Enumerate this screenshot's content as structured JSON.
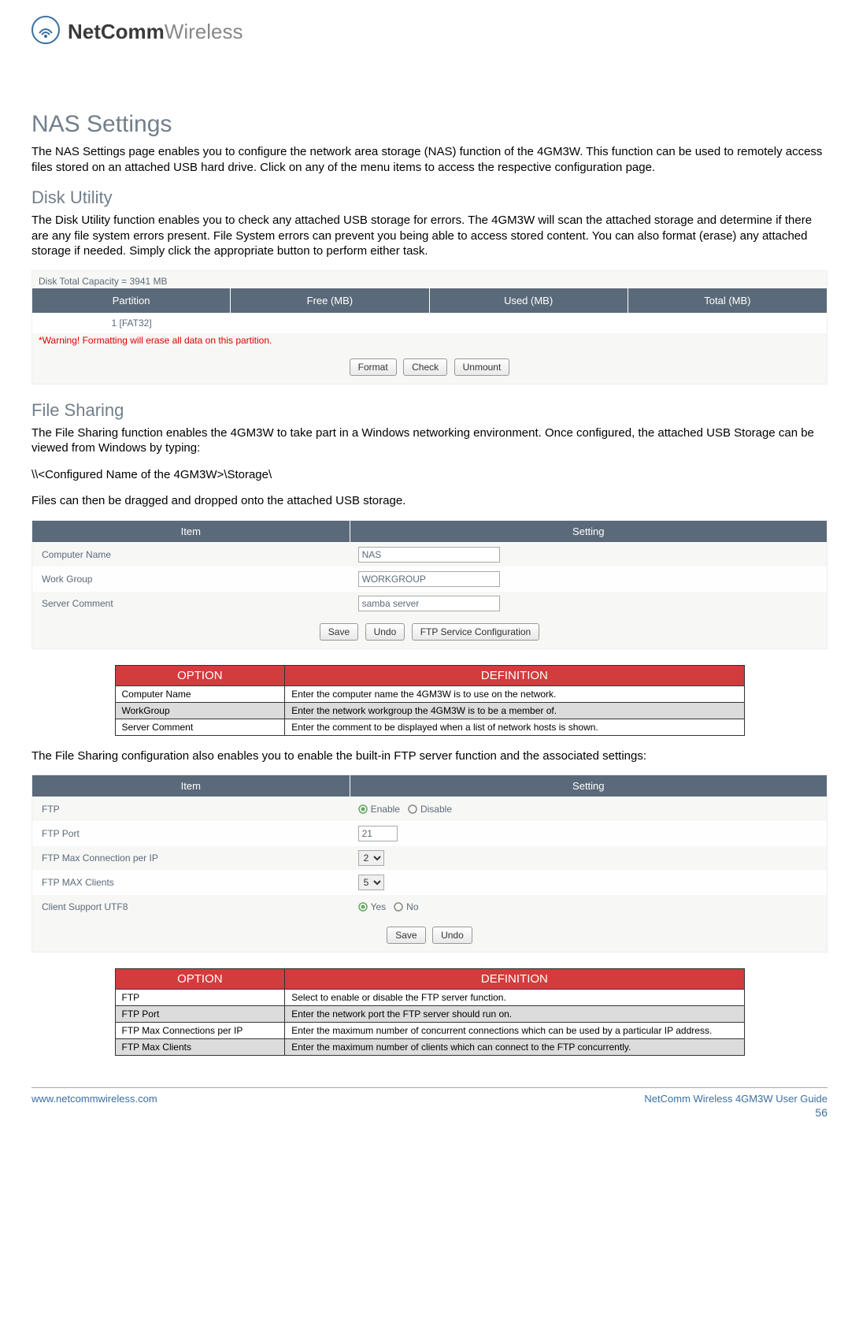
{
  "logo": {
    "bold": "NetComm",
    "light": "Wireless"
  },
  "h1": "NAS Settings",
  "intro": "The NAS Settings page enables you to configure the network area storage (NAS) function of the 4GM3W. This function can be used to remotely access files stored on an attached USB hard drive. Click on any of the menu items to access the respective configuration page.",
  "disk": {
    "title": "Disk Utility",
    "para": "The Disk Utility function enables you to check any attached USB storage for errors. The 4GM3W will scan the attached storage and determine if there are any file system errors present. File System errors can prevent you being able to access stored content. You can also format (erase) any attached storage if needed. Simply click the appropriate button to perform either task.",
    "capacity": "Disk Total Capacity = 3941 MB",
    "headers": [
      "Partition",
      "Free (MB)",
      "Used (MB)",
      "Total (MB)"
    ],
    "row": [
      "1 [FAT32]",
      "",
      "",
      ""
    ],
    "warning": "*Warning! Formatting will erase all data on this partition.",
    "buttons": [
      "Format",
      "Check",
      "Unmount"
    ]
  },
  "fs": {
    "title": "File Sharing",
    "p1": "The File Sharing function enables the 4GM3W to take part in a Windows networking environment. Once configured, the attached USB Storage can be viewed from Windows by typing:",
    "path": "\\\\<Configured Name of the 4GM3W>\\Storage\\",
    "p2": "Files can then be dragged and dropped onto the attached USB storage.",
    "headers": [
      "Item",
      "Setting"
    ],
    "rows": [
      {
        "label": "Computer Name",
        "value": "NAS"
      },
      {
        "label": "Work Group",
        "value": "WORKGROUP"
      },
      {
        "label": "Server Comment",
        "value": "samba server"
      }
    ],
    "buttons": [
      "Save",
      "Undo",
      "FTP Service Configuration"
    ]
  },
  "defs1": {
    "headers": [
      "OPTION",
      "DEFINITION"
    ],
    "rows": [
      [
        "Computer Name",
        "Enter the computer name the 4GM3W is to use on the network."
      ],
      [
        "WorkGroup",
        "Enter the network workgroup the 4GM3W is to be a member of."
      ],
      [
        "Server Comment",
        "Enter the comment to be displayed when a list of network hosts is shown."
      ]
    ]
  },
  "ftpIntro": "The File Sharing configuration also enables you to enable the built-in FTP server function and the associated settings:",
  "ftp": {
    "headers": [
      "Item",
      "Setting"
    ],
    "rows": [
      {
        "label": "FTP",
        "type": "radio",
        "opts": [
          "Enable",
          "Disable"
        ],
        "selected": "Enable"
      },
      {
        "label": "FTP Port",
        "type": "text",
        "value": "21"
      },
      {
        "label": "FTP Max Connection per IP",
        "type": "select",
        "value": "2"
      },
      {
        "label": "FTP MAX Clients",
        "type": "select",
        "value": "5"
      },
      {
        "label": "Client Support UTF8",
        "type": "radio",
        "opts": [
          "Yes",
          "No"
        ],
        "selected": "Yes"
      }
    ],
    "buttons": [
      "Save",
      "Undo"
    ]
  },
  "defs2": {
    "headers": [
      "OPTION",
      "DEFINITION"
    ],
    "rows": [
      [
        "FTP",
        "Select to enable or disable the FTP server function."
      ],
      [
        "FTP Port",
        "Enter the network port the FTP server should run on."
      ],
      [
        "FTP Max Connections per IP",
        "Enter the maximum number of concurrent connections which can be used by a particular IP address."
      ],
      [
        "FTP Max Clients",
        "Enter the maximum number of clients which can connect to the FTP concurrently."
      ]
    ]
  },
  "footer": {
    "left": "www.netcommwireless.com",
    "right": "NetComm Wireless 4GM3W User Guide",
    "page": "56"
  }
}
